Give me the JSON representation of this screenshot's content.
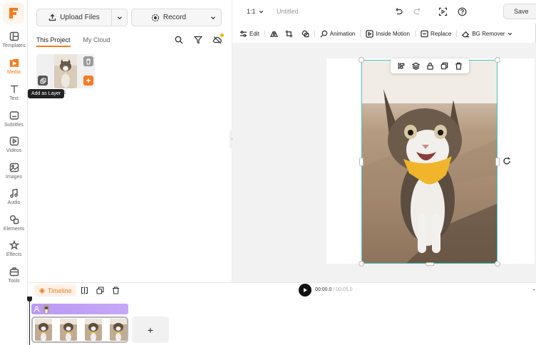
{
  "rail": {
    "items": [
      {
        "label": "Templates",
        "icon": "templates-icon"
      },
      {
        "label": "Media",
        "icon": "media-icon",
        "active": true
      },
      {
        "label": "Text",
        "icon": "text-icon"
      },
      {
        "label": "Subtitles",
        "icon": "subtitles-icon"
      },
      {
        "label": "Videos",
        "icon": "videos-icon"
      },
      {
        "label": "Images",
        "icon": "images-icon"
      },
      {
        "label": "Audio",
        "icon": "audio-icon"
      },
      {
        "label": "Elements",
        "icon": "elements-icon"
      },
      {
        "label": "Effects",
        "icon": "effects-icon"
      },
      {
        "label": "Tools",
        "icon": "tools-icon"
      }
    ]
  },
  "panel": {
    "upload_label": "Upload Files",
    "record_label": "Record",
    "tabs": [
      {
        "label": "This Project",
        "active": true
      },
      {
        "label": "My Cloud",
        "active": false
      }
    ],
    "tooltip": "Add as Layer",
    "card_name": "1"
  },
  "topbar": {
    "ratio": "1:1",
    "title": "Untitled",
    "save_label": "Save"
  },
  "edit_bar": {
    "edit": "Edit",
    "animation": "Animation",
    "inside_motion": "Inside Motion",
    "replace": "Replace",
    "bg_remover": "BG Remover"
  },
  "timeline": {
    "tab_label": "Timeline",
    "current_time": "00:00.0",
    "separator": " / ",
    "total_time": "00:05.0",
    "add_label": "+"
  },
  "colors": {
    "accent": "#f47b20",
    "selection": "#3ec9c3",
    "audio_track": "#b99af5"
  }
}
